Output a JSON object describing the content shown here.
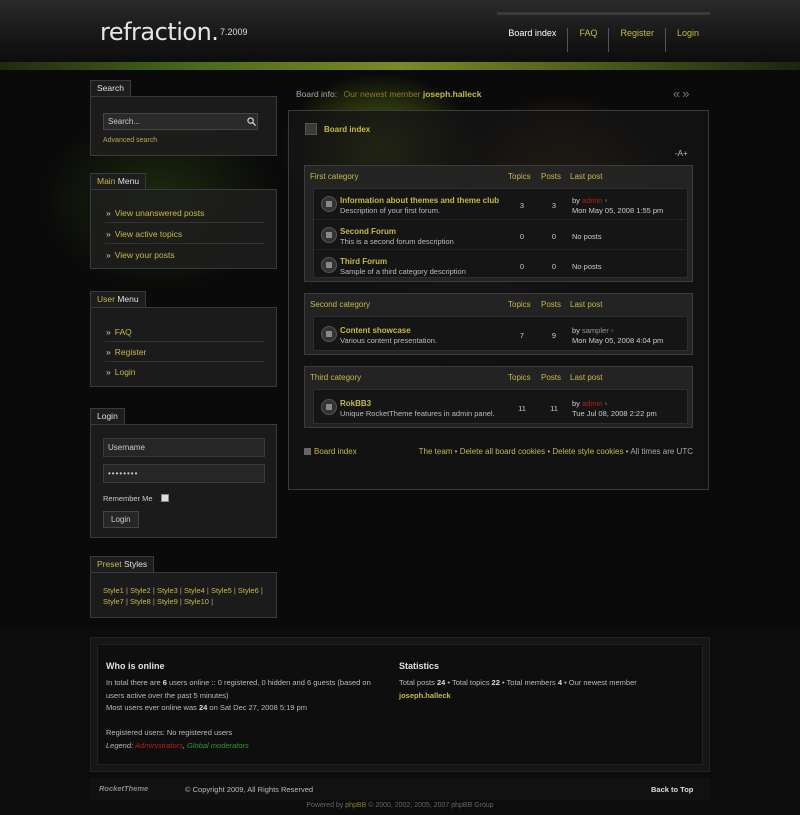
{
  "header": {
    "logo": "refraction.",
    "version": "7.2009",
    "nav": [
      "Board index",
      "FAQ",
      "Register",
      "Login"
    ]
  },
  "sidebar": {
    "search": {
      "tab": "Search",
      "placeholder": "Search...",
      "advanced": "Advanced search"
    },
    "main_menu": {
      "tab_a": "Main",
      "tab_b": " Menu",
      "items": [
        "View unanswered posts",
        "View active topics",
        "View your posts"
      ]
    },
    "user_menu": {
      "tab_a": "User",
      "tab_b": " Menu",
      "items": [
        "FAQ",
        "Register",
        "Login"
      ]
    },
    "login": {
      "tab": "Login",
      "username": "Username",
      "password": "••••••••",
      "remember": "Remember Me",
      "button": "Login"
    },
    "preset": {
      "tab_a": "Preset",
      "tab_b": " Styles",
      "styles": [
        "Style1",
        "Style2",
        "Style3",
        "Style4",
        "Style5",
        "Style6",
        "Style7",
        "Style8",
        "Style9",
        "Style10"
      ]
    }
  },
  "board": {
    "info_label": "Board info:",
    "info_text": "Our newest member",
    "newest_member": "joseph.halleck",
    "breadcrumb": "Board index",
    "font_size": "-A+",
    "col_topics": "Topics",
    "col_posts": "Posts",
    "col_last": "Last post",
    "categories": [
      {
        "name": "First category",
        "forums": [
          {
            "name": "Information about themes and theme club",
            "desc": "Description of your first forum.",
            "topics": "3",
            "posts": "3",
            "by": "by",
            "user": "admin",
            "date": "Mon May 05, 2008 1:55 pm"
          },
          {
            "name": "Second Forum",
            "desc": "This is a second forum description",
            "topics": "0",
            "posts": "0",
            "no_posts": "No posts"
          },
          {
            "name": "Third Forum",
            "desc": "Sample of a third category description",
            "topics": "0",
            "posts": "0",
            "no_posts": "No posts"
          }
        ]
      },
      {
        "name": "Second category",
        "forums": [
          {
            "name": "Content showcase",
            "desc": "Various content presentation.",
            "topics": "7",
            "posts": "9",
            "by": "by",
            "user": "sampler",
            "date": "Mon May 05, 2008 4:04 pm"
          }
        ]
      },
      {
        "name": "Third category",
        "forums": [
          {
            "name": "RokBB3",
            "desc": "Unique RocketTheme features in admin panel.",
            "topics": "11",
            "posts": "11",
            "by": "by",
            "user": "admin",
            "date": "Tue Jul 08, 2008 2:22 pm"
          }
        ]
      }
    ],
    "footer_home": "Board index",
    "footer_team": "The team",
    "footer_sep": " • ",
    "footer_delete": "Delete all board cookies",
    "footer_style": "Delete style cookies",
    "footer_tz": "All times are UTC"
  },
  "online": {
    "title": "Who is online",
    "line1a": "In total there are ",
    "line1b": "6",
    "line1c": " users online :: 0 registered, 0 hidden and 6 guests (based on",
    "line2": "users active over the past 5 minutes)",
    "line3a": "Most users ever online was ",
    "line3b": "24",
    "line3c": " on Sat Dec 27, 2008 5:19 pm",
    "registered": "Registered users: No registered users",
    "legend_label": "Legend:",
    "legend_admins": "Administrators",
    "legend_sep": ", ",
    "legend_mods": "Global moderators"
  },
  "statistics": {
    "title": "Statistics",
    "a": "Total posts ",
    "b": "24",
    "c": " • Total topics ",
    "d": "22",
    "e": " • Total members ",
    "f": "4",
    "g": " • Our newest member",
    "member": "joseph.halleck"
  },
  "footer": {
    "logo": "RocketTheme",
    "copyright": "© Copyright 2009, All Rights Reserved",
    "back_to_top": "Back to Top",
    "powered_a": "Powered by ",
    "powered_b": "phpBB",
    "powered_c": " © 2000, 2002, 2005, 2007 phpBB Group"
  },
  "colors": {
    "accent": "#c8b84a",
    "admin_red": "#b02020",
    "mod_green": "#2f9c2f",
    "background": "#0b0b0b"
  }
}
